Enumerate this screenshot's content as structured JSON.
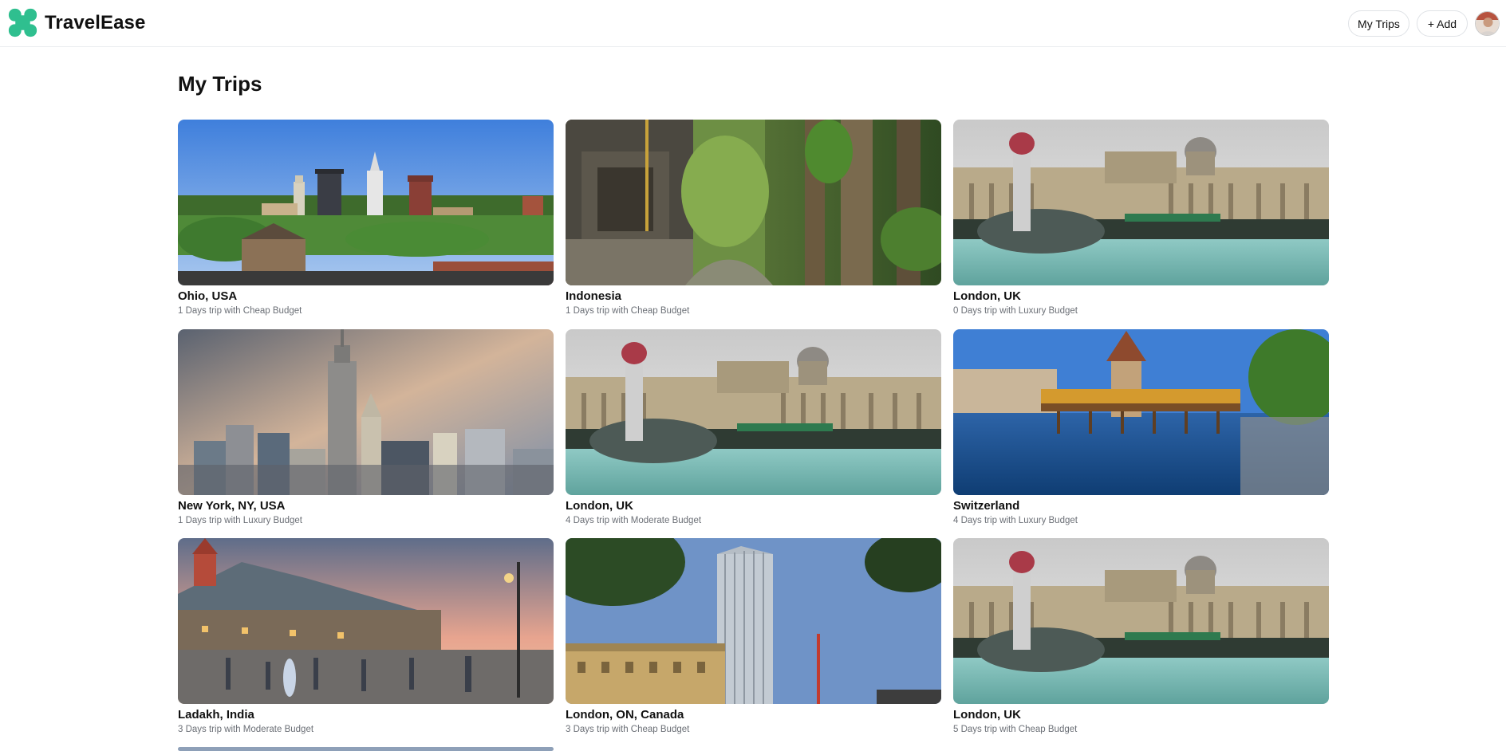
{
  "app": {
    "name": "TravelEase",
    "logo_icon": "clover-logo-icon",
    "brand_color": "#2fbf8f"
  },
  "header": {
    "my_trips_label": "My Trips",
    "add_label": "+ Add",
    "avatar_icon": "user-avatar"
  },
  "page": {
    "title": "My Trips"
  },
  "trips": [
    {
      "title": "Ohio, USA",
      "subtitle": "1 Days trip with Cheap Budget",
      "image": "city-skyline-photo"
    },
    {
      "title": "Indonesia",
      "subtitle": "1 Days trip with Cheap Budget",
      "image": "jungle-temple-photo"
    },
    {
      "title": "London, UK",
      "subtitle": "0 Days trip with Luxury Budget",
      "image": "trafalgar-square-photo"
    },
    {
      "title": "New York, NY, USA",
      "subtitle": "1 Days trip with Luxury Budget",
      "image": "manhattan-skyline-photo"
    },
    {
      "title": "London, UK",
      "subtitle": "4 Days trip with Moderate Budget",
      "image": "trafalgar-square-photo"
    },
    {
      "title": "Switzerland",
      "subtitle": "4 Days trip with Luxury Budget",
      "image": "chapel-bridge-photo"
    },
    {
      "title": "Ladakh, India",
      "subtitle": "3 Days trip with Moderate Budget",
      "image": "mountain-mall-photo"
    },
    {
      "title": "London, ON, Canada",
      "subtitle": "3 Days trip with Cheap Budget",
      "image": "modern-tower-photo"
    },
    {
      "title": "London, UK",
      "subtitle": "5 Days trip with Cheap Budget",
      "image": "trafalgar-square-photo"
    }
  ]
}
